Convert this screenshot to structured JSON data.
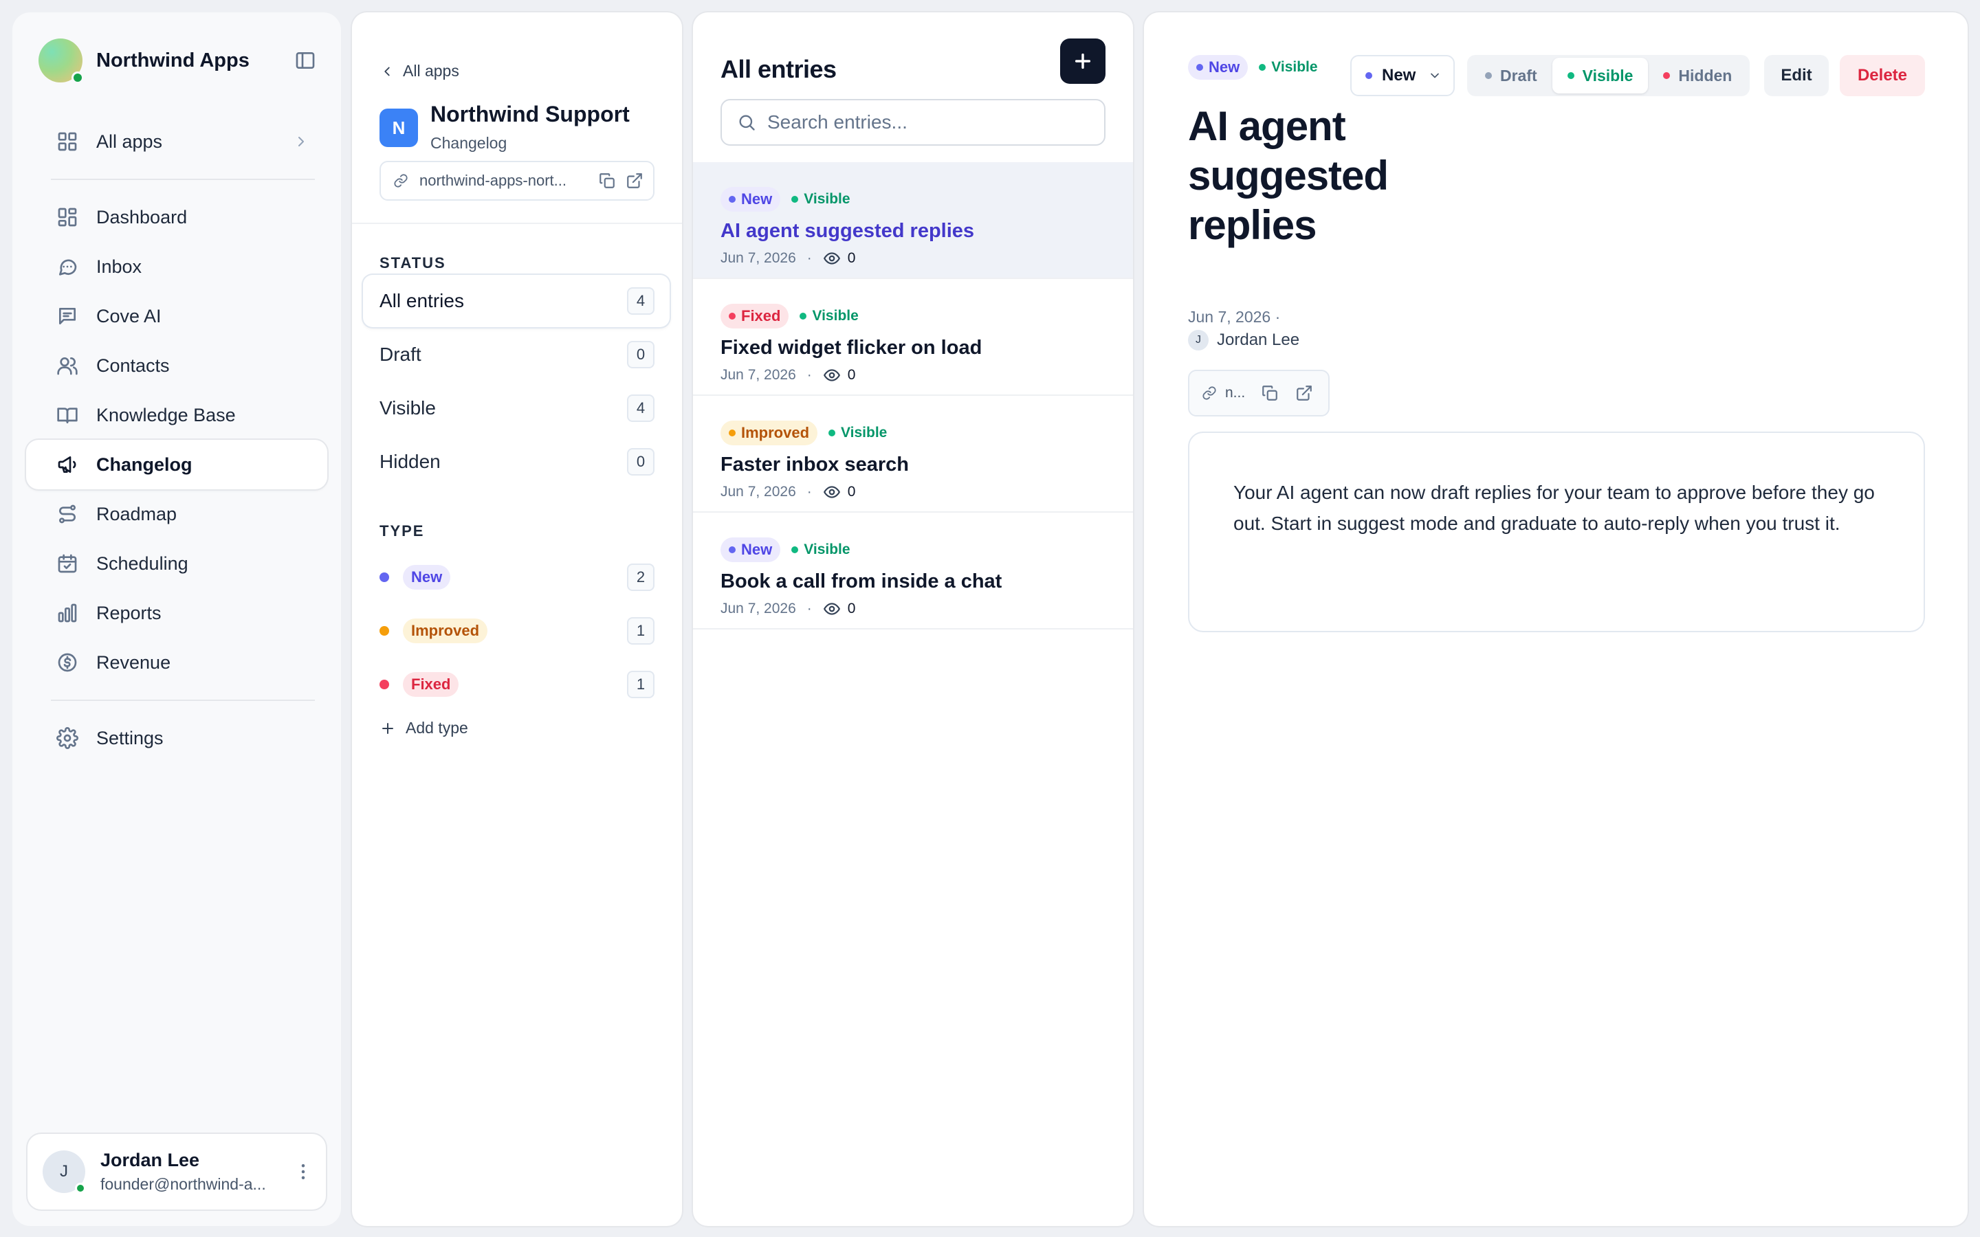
{
  "sidebar": {
    "brand": "Northwind Apps",
    "nav_top": [
      {
        "label": "All apps",
        "icon": "grid-icon"
      }
    ],
    "nav_main": [
      {
        "label": "Dashboard",
        "icon": "dashboard-icon"
      },
      {
        "label": "Inbox",
        "icon": "chat-icon"
      },
      {
        "label": "Cove AI",
        "icon": "ai-chat-icon"
      },
      {
        "label": "Contacts",
        "icon": "users-icon"
      },
      {
        "label": "Knowledge Base",
        "icon": "book-icon"
      },
      {
        "label": "Changelog",
        "icon": "megaphone-icon",
        "active": true
      },
      {
        "label": "Roadmap",
        "icon": "route-icon"
      },
      {
        "label": "Scheduling",
        "icon": "calendar-icon"
      },
      {
        "label": "Reports",
        "icon": "bar-chart-icon"
      },
      {
        "label": "Revenue",
        "icon": "dollar-icon"
      }
    ],
    "nav_bottom": [
      {
        "label": "Settings",
        "icon": "gear-icon"
      }
    ],
    "user": {
      "initial": "J",
      "name": "Jordan Lee",
      "email": "founder@northwind-a..."
    }
  },
  "app_panel": {
    "back_label": "All apps",
    "app_initial": "N",
    "app_name": "Northwind Support",
    "app_section": "Changelog",
    "url": "northwind-apps-nort...",
    "status_heading": "STATUS",
    "status_filters": [
      {
        "label": "All entries",
        "count": "4",
        "active": true
      },
      {
        "label": "Draft",
        "count": "0"
      },
      {
        "label": "Visible",
        "count": "4"
      },
      {
        "label": "Hidden",
        "count": "0"
      }
    ],
    "type_heading": "TYPE",
    "type_filters": [
      {
        "label": "New",
        "count": "2",
        "color": "#6366f1",
        "style": "new"
      },
      {
        "label": "Improved",
        "count": "1",
        "color": "#f59e0b",
        "style": "improved"
      },
      {
        "label": "Fixed",
        "count": "1",
        "color": "#f43f5e",
        "style": "fixed"
      }
    ],
    "add_type_label": "Add type"
  },
  "entries_panel": {
    "title": "All entries",
    "search_placeholder": "Search entries...",
    "entries": [
      {
        "type": "New",
        "type_style": "new",
        "status": "Visible",
        "title": "AI agent suggested replies",
        "date": "Jun 7, 2026",
        "views": "0",
        "selected": true
      },
      {
        "type": "Fixed",
        "type_style": "fixed",
        "status": "Visible",
        "title": "Fixed widget flicker on load",
        "date": "Jun 7, 2026",
        "views": "0"
      },
      {
        "type": "Improved",
        "type_style": "improved",
        "status": "Visible",
        "title": "Faster inbox search",
        "date": "Jun 7, 2026",
        "views": "0"
      },
      {
        "type": "New",
        "type_style": "new",
        "status": "Visible",
        "title": "Book a call from inside a chat",
        "date": "Jun 7, 2026",
        "views": "0"
      }
    ]
  },
  "detail": {
    "type_tag": "New",
    "status_tag": "Visible",
    "type_select": "New",
    "status_options": [
      {
        "label": "Draft",
        "color": "#94a3b8"
      },
      {
        "label": "Visible",
        "color": "#10b981",
        "active": true
      },
      {
        "label": "Hidden",
        "color": "#f43f5e"
      }
    ],
    "edit_label": "Edit",
    "delete_label": "Delete",
    "title": "AI agent suggested replies",
    "date": "Jun 7, 2026 ·",
    "author_initial": "J",
    "author": "Jordan Lee",
    "url": "n...",
    "body": "Your AI agent can now draft replies for your team to approve before they go out. Start in suggest mode and graduate to auto-reply when you trust it."
  },
  "colors": {
    "accent": "#4338ca",
    "visible_green": "#059669",
    "new_purple": "#6366f1",
    "improved_amber": "#f59e0b",
    "fixed_red": "#f43f5e",
    "primary_dark": "#0f172a"
  }
}
